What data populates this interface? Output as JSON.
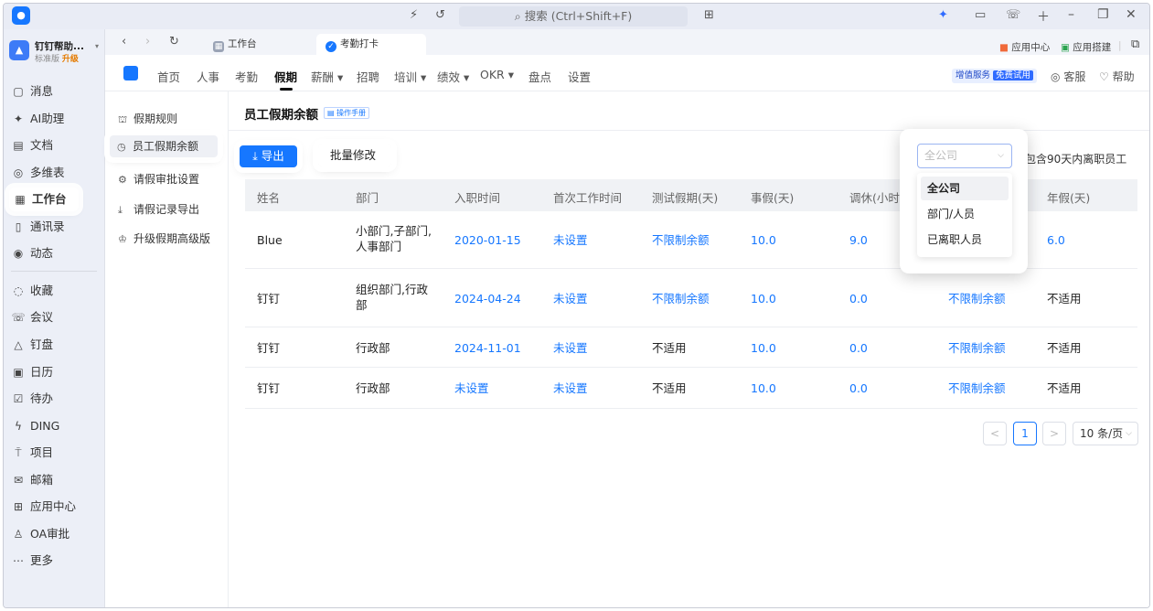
{
  "titlebar": {
    "search_placeholder": "搜索 (Ctrl+Shift+F)",
    "icons": [
      "app-logo",
      "ai-beta-icon",
      "history-icon",
      "grid-icon",
      "ai-icon",
      "monitor-icon",
      "call-icon",
      "plus-icon",
      "minimize-icon",
      "restore-icon",
      "close-icon"
    ]
  },
  "sidebar": {
    "org_name": "钉钉帮助...",
    "org_edition": "标准版",
    "org_upgrade": "升级",
    "items": [
      {
        "label": "消息",
        "icon": "message-icon"
      },
      {
        "label": "AI助理",
        "icon": "ai-assistant-icon"
      },
      {
        "label": "文档",
        "icon": "document-icon"
      },
      {
        "label": "多维表",
        "icon": "table-icon"
      },
      {
        "label": "工作台",
        "icon": "workbench-icon"
      },
      {
        "label": "通讯录",
        "icon": "contacts-icon"
      },
      {
        "label": "动态",
        "icon": "moments-icon"
      },
      {
        "label": "收藏",
        "icon": "favorite-icon"
      },
      {
        "label": "会议",
        "icon": "meeting-icon"
      },
      {
        "label": "钉盘",
        "icon": "drive-icon"
      },
      {
        "label": "日历",
        "icon": "calendar-icon"
      },
      {
        "label": "待办",
        "icon": "todo-icon"
      },
      {
        "label": "DING",
        "icon": "ding-icon"
      },
      {
        "label": "项目",
        "icon": "project-icon"
      },
      {
        "label": "邮箱",
        "icon": "mail-icon"
      },
      {
        "label": "应用中心",
        "icon": "app-center-icon"
      },
      {
        "label": "OA审批",
        "icon": "approval-icon"
      },
      {
        "label": "更多",
        "icon": "more-icon"
      }
    ]
  },
  "tabs": {
    "items": [
      {
        "label": "工作台"
      },
      {
        "label": "考勤打卡"
      }
    ],
    "right_app_center": "应用中心",
    "right_app_build": "应用搭建"
  },
  "appmenu": {
    "items": [
      {
        "label": "首页"
      },
      {
        "label": "人事"
      },
      {
        "label": "考勤"
      },
      {
        "label": "假期"
      },
      {
        "label": "薪酬 ▾"
      },
      {
        "label": "招聘"
      },
      {
        "label": "培训 ▾"
      },
      {
        "label": "绩效 ▾"
      },
      {
        "label": "OKR ▾"
      },
      {
        "label": "盘点"
      },
      {
        "label": "设置"
      }
    ],
    "value_service": "增值服务",
    "free_trial": "免费试用",
    "service": "客服",
    "help": "帮助"
  },
  "inner_menu": {
    "items": [
      {
        "label": "假期规则"
      },
      {
        "label": "员工假期余额"
      },
      {
        "label": "请假审批设置"
      },
      {
        "label": "请假记录导出"
      },
      {
        "label": "升级假期高级版"
      }
    ]
  },
  "main": {
    "title": "员工假期余额",
    "manual": "操作手册",
    "export_label": "导出",
    "batch_label": "批量修改",
    "include_left": "包含90天内离职员工",
    "scope_placeholder": "全公司",
    "scope_options": [
      "全公司",
      "部门/人员",
      "已离职人员"
    ]
  },
  "table": {
    "columns": [
      "姓名",
      "部门",
      "入职时间",
      "首次工作时间",
      "测试假期(天)",
      "事假(天)",
      "调休(小时)",
      "",
      "年假(天)"
    ],
    "rows": [
      {
        "name": "Blue",
        "dept": "小部门,子部门,人事部门",
        "hire": "2020-01-15",
        "first_work": "未设置",
        "test_leave": "不限制余额",
        "personal": "10.0",
        "comp": "9.0",
        "hidden": "",
        "annual": "6.0"
      },
      {
        "name": "钉钉",
        "dept": "组织部门,行政部",
        "hire": "2024-04-24",
        "first_work": "未设置",
        "test_leave": "不限制余额",
        "personal": "10.0",
        "comp": "0.0",
        "hidden": "不限制余额",
        "annual": "不适用"
      },
      {
        "name": "钉钉",
        "dept": "行政部",
        "hire": "2024-11-01",
        "first_work": "未设置",
        "test_leave": "不适用",
        "personal": "10.0",
        "comp": "0.0",
        "hidden": "不限制余额",
        "annual": "不适用"
      },
      {
        "name": "钉钉",
        "dept": "行政部",
        "hire": "未设置",
        "first_work": "未设置",
        "test_leave": "不适用",
        "personal": "10.0",
        "comp": "0.0",
        "hidden": "不限制余额",
        "annual": "不适用"
      }
    ]
  },
  "pagination": {
    "prev": "<",
    "page": "1",
    "next": ">",
    "size": "10 条/页"
  }
}
